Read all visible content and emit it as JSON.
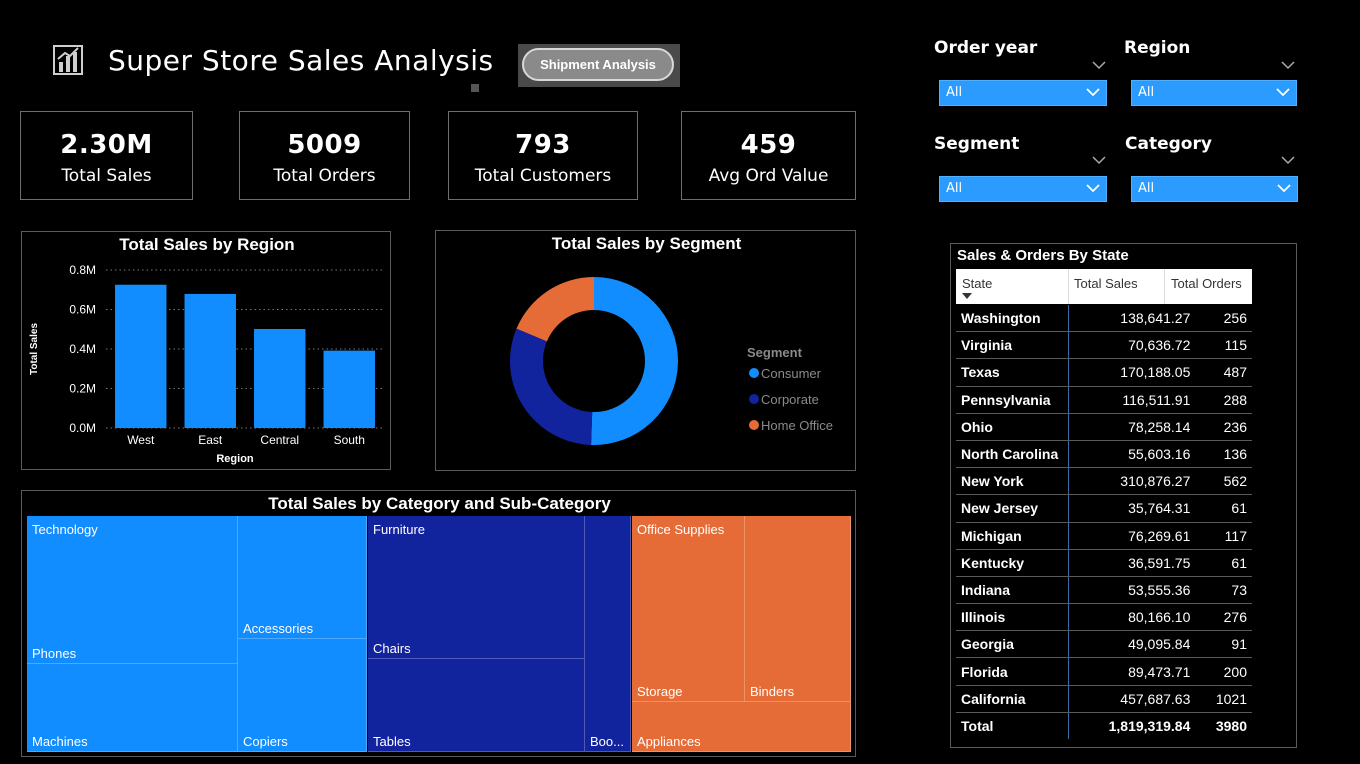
{
  "header": {
    "title": "Super Store Sales Analysis",
    "nav_button": "Shipment Analysis",
    "icon": "bar-chart-icon"
  },
  "kpis": [
    {
      "value": "2.30M",
      "label": "Total Sales"
    },
    {
      "value": "5009",
      "label": "Total Orders"
    },
    {
      "value": "793",
      "label": "Total Customers"
    },
    {
      "value": "459",
      "label": "Avg Ord Value"
    }
  ],
  "filters": [
    {
      "label": "Order year",
      "value": "All"
    },
    {
      "label": "Region",
      "value": "All"
    },
    {
      "label": "Segment",
      "value": "All"
    },
    {
      "label": "Category",
      "value": "All"
    }
  ],
  "colors": {
    "consumer": "#118dff",
    "corporate": "#12239e",
    "home_office": "#e66c37",
    "dropdown": "#2b9bff"
  },
  "chart_data": [
    {
      "type": "bar",
      "title": "Total Sales by Region",
      "xlabel": "Region",
      "ylabel": "Total Sales",
      "categories": [
        "West",
        "East",
        "Central",
        "South"
      ],
      "values": [
        725458,
        678781,
        501240,
        391722
      ],
      "ylim": [
        0,
        800000
      ],
      "ticks": [
        "0.0M",
        "0.2M",
        "0.4M",
        "0.6M",
        "0.8M"
      ],
      "grid": true
    },
    {
      "type": "pie",
      "title": "Total Sales by Segment",
      "legend_title": "Segment",
      "legend_position": "right",
      "labels": [
        "Consumer",
        "Corporate",
        "Home Office"
      ],
      "values": [
        1161401,
        706146,
        429653
      ]
    },
    {
      "type": "treemap",
      "title": "Total Sales by Category and Sub-Category",
      "groups": [
        {
          "name": "Technology",
          "children": [
            "Phones",
            "Machines",
            "Accessories",
            "Copiers"
          ]
        },
        {
          "name": "Furniture",
          "children": [
            "Chairs",
            "Tables",
            "Boo..."
          ]
        },
        {
          "name": "Office Supplies",
          "children": [
            "Storage",
            "Binders",
            "Appliances"
          ]
        }
      ]
    }
  ],
  "state_table": {
    "title": "Sales & Orders By State",
    "columns": [
      "State",
      "Total Sales",
      "Total Orders"
    ],
    "rows": [
      [
        "Washington",
        "138,641.27",
        "256"
      ],
      [
        "Virginia",
        "70,636.72",
        "115"
      ],
      [
        "Texas",
        "170,188.05",
        "487"
      ],
      [
        "Pennsylvania",
        "116,511.91",
        "288"
      ],
      [
        "Ohio",
        "78,258.14",
        "236"
      ],
      [
        "North Carolina",
        "55,603.16",
        "136"
      ],
      [
        "New York",
        "310,876.27",
        "562"
      ],
      [
        "New Jersey",
        "35,764.31",
        "61"
      ],
      [
        "Michigan",
        "76,269.61",
        "117"
      ],
      [
        "Kentucky",
        "36,591.75",
        "61"
      ],
      [
        "Indiana",
        "53,555.36",
        "73"
      ],
      [
        "Illinois",
        "80,166.10",
        "276"
      ],
      [
        "Georgia",
        "49,095.84",
        "91"
      ],
      [
        "Florida",
        "89,473.71",
        "200"
      ],
      [
        "California",
        "457,687.63",
        "1021"
      ]
    ],
    "total": [
      "Total",
      "1,819,319.84",
      "3980"
    ]
  }
}
